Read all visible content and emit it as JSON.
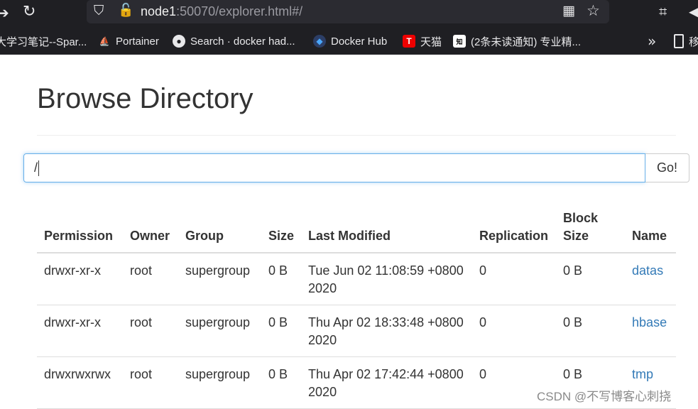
{
  "browser": {
    "url_host": "node1",
    "url_rest": ":50070/explorer.html#/",
    "bookmarks": [
      {
        "label": "大学习笔记--Spar...",
        "icon": "bookmark-folder-icon"
      },
      {
        "label": "Portainer",
        "icon": "portainer-icon"
      },
      {
        "label": "Search · docker had...",
        "icon": "github-icon"
      },
      {
        "label": "Docker Hub",
        "icon": "docker-icon"
      },
      {
        "label": "天猫",
        "icon": "tmall-icon"
      },
      {
        "label": "(2条未读通知) 专业精...",
        "icon": "zhihu-icon"
      },
      {
        "label": "移",
        "icon": "mobile-icon"
      }
    ]
  },
  "page": {
    "title": "Browse Directory",
    "path_value": "/",
    "go_label": "Go!",
    "table": {
      "headers": [
        "Permission",
        "Owner",
        "Group",
        "Size",
        "Last Modified",
        "Replication",
        "Block Size",
        "Name"
      ],
      "rows": [
        {
          "permission": "drwxr-xr-x",
          "owner": "root",
          "group": "supergroup",
          "size": "0 B",
          "modified": "Tue Jun 02 11:08:59 +0800 2020",
          "replication": "0",
          "block_size": "0 B",
          "name": "datas"
        },
        {
          "permission": "drwxr-xr-x",
          "owner": "root",
          "group": "supergroup",
          "size": "0 B",
          "modified": "Thu Apr 02 18:33:48 +0800 2020",
          "replication": "0",
          "block_size": "0 B",
          "name": "hbase"
        },
        {
          "permission": "drwxrwxrwx",
          "owner": "root",
          "group": "supergroup",
          "size": "0 B",
          "modified": "Thu Apr 02 17:42:44 +0800 2020",
          "replication": "0",
          "block_size": "0 B",
          "name": "tmp"
        }
      ]
    }
  },
  "watermark": "CSDN @不写博客心刺挠",
  "colors": {
    "link": "#337ab7",
    "browser_bg": "#1f1f23"
  }
}
